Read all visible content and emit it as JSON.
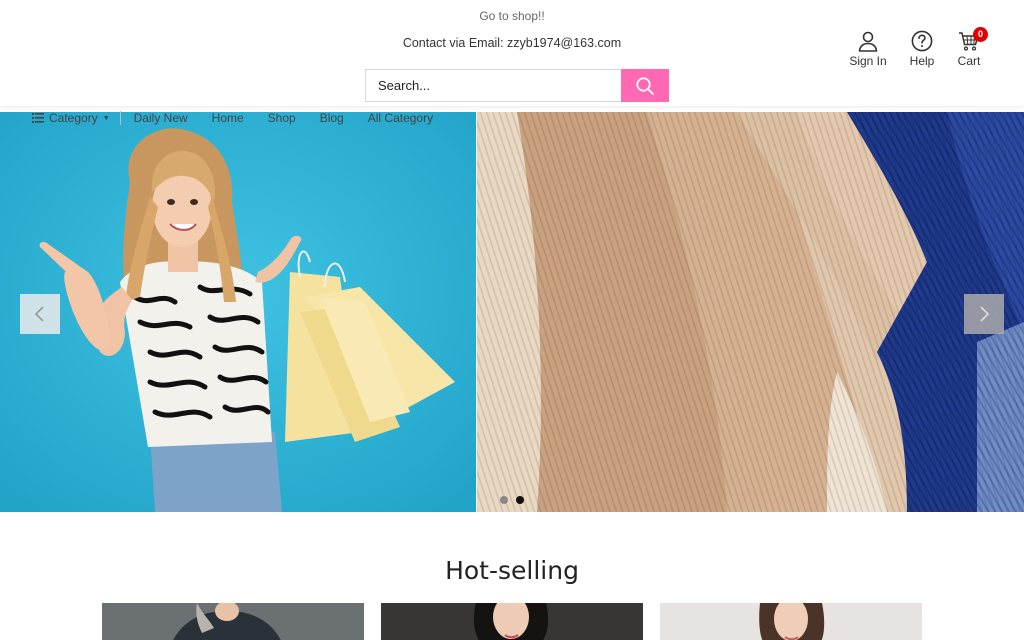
{
  "header": {
    "promo_text": "Go to shop!!",
    "contact_text": "Contact via Email: zzyb1974@163.com",
    "search": {
      "placeholder": "Search...",
      "icon": "search-icon"
    },
    "actions": {
      "sign_in": "Sign In",
      "help": "Help",
      "cart": "Cart",
      "cart_count": "0"
    },
    "accent_color": "#ff69b4"
  },
  "nav": {
    "category_label": "Category",
    "links": [
      "Daily New",
      "Home",
      "Shop",
      "Blog",
      "All Category"
    ]
  },
  "hero": {
    "slides": [
      "woman-with-shopping-bags",
      "knit-sweaters"
    ],
    "active_slide": 2,
    "slide_count": 2
  },
  "section": {
    "title": "Hot-selling"
  }
}
